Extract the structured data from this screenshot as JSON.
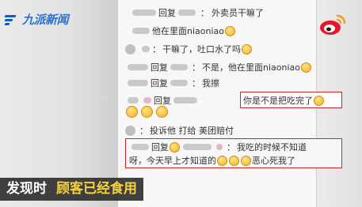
{
  "brand": {
    "logo_text": "九派新闻"
  },
  "comments": [
    {
      "label": "回复",
      "text": "外卖员干嘛了"
    },
    {
      "label": "",
      "text": "他在里面niaoniao"
    },
    {
      "label": "",
      "text": "干嘛了，吐口水了吗"
    },
    {
      "label": "回复",
      "text": "不是，他在里面niaoniao"
    },
    {
      "label": "回复",
      "text": "我擦"
    },
    {
      "label": "回复",
      "text": "你是不是把吃完了"
    },
    {
      "label": "",
      "text": "投诉他 打给 美团赔付"
    },
    {
      "label": "回复",
      "text": "我吃的时候不知道"
    },
    {
      "label": "",
      "text": "呀，今天早上才知道的"
    },
    {
      "label": "",
      "text": "恶心死我了"
    }
  ],
  "caption": {
    "part1": "发现时",
    "part2": "顾客已经食用"
  },
  "colors": {
    "highlight_box": "#d3262b",
    "caption_yellow": "#f3d23b",
    "logo_blue": "#0a5fcf"
  },
  "icons": [
    "brand-logo-icon",
    "weibo-icon",
    "emoji-icon",
    "avatar-icon"
  ]
}
